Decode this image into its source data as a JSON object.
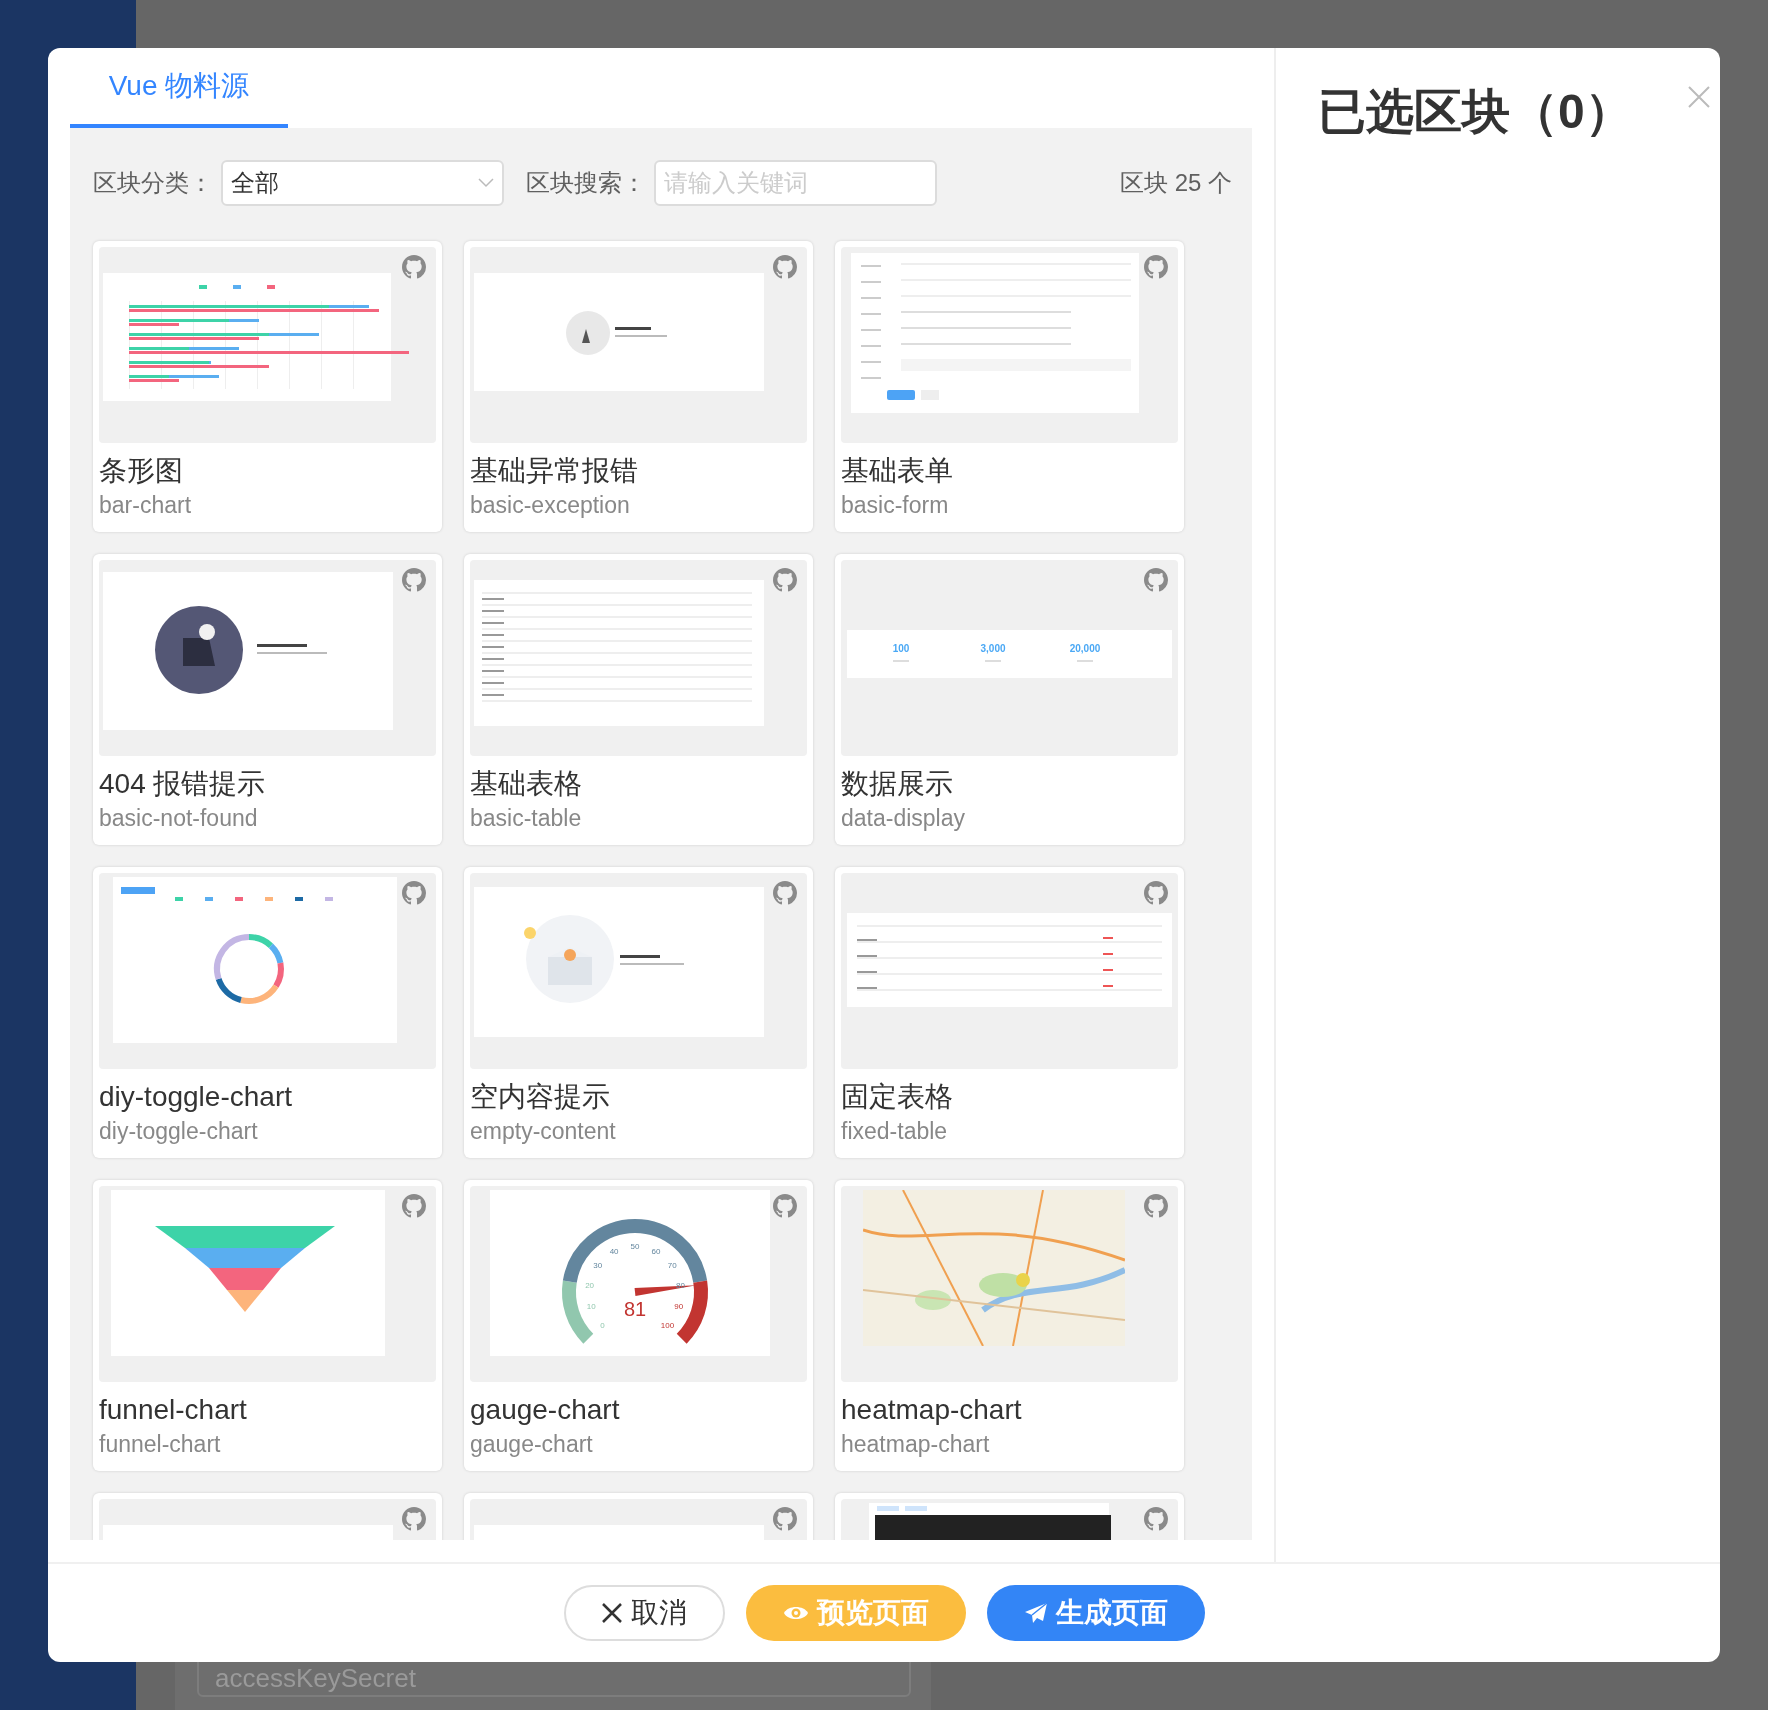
{
  "background": {
    "field_placeholder": "accessKeySecret"
  },
  "tab": {
    "label": "Vue 物料源",
    "selected": true
  },
  "filters": {
    "category_label": "区块分类：",
    "category_value": "全部",
    "search_label": "区块搜索：",
    "search_placeholder": "请输入关键词",
    "count": "区块 25 个"
  },
  "blocks": [
    {
      "title": "条形图",
      "name": "bar-chart",
      "kind": "bar"
    },
    {
      "title": "基础异常报错",
      "name": "basic-exception",
      "kind": "exception"
    },
    {
      "title": "基础表单",
      "name": "basic-form",
      "kind": "form"
    },
    {
      "title": "404 报错提示",
      "name": "basic-not-found",
      "kind": "notfound"
    },
    {
      "title": "基础表格",
      "name": "basic-table",
      "kind": "table"
    },
    {
      "title": "数据展示",
      "name": "data-display",
      "kind": "stats",
      "figures": [
        "100",
        "3,000",
        "20,000"
      ]
    },
    {
      "title": "diy-toggle-chart",
      "name": "diy-toggle-chart",
      "kind": "ring"
    },
    {
      "title": "空内容提示",
      "name": "empty-content",
      "kind": "empty"
    },
    {
      "title": "固定表格",
      "name": "fixed-table",
      "kind": "fixedtable"
    },
    {
      "title": "funnel-chart",
      "name": "funnel-chart",
      "kind": "funnel"
    },
    {
      "title": "gauge-chart",
      "name": "gauge-chart",
      "kind": "gauge",
      "reading": "81",
      "ticks": [
        "0",
        "10",
        "20",
        "30",
        "40",
        "50",
        "60",
        "70",
        "80",
        "90",
        "100"
      ]
    },
    {
      "title": "heatmap-chart",
      "name": "heatmap-chart",
      "kind": "map"
    },
    {
      "kind": "blank"
    },
    {
      "kind": "blank"
    },
    {
      "kind": "dark"
    }
  ],
  "selected_panel": {
    "title": "已选区块（0）"
  },
  "buttons": [
    {
      "kind": "cancel",
      "label": "取消"
    },
    {
      "kind": "preview",
      "label": "预览页面"
    },
    {
      "kind": "generate",
      "label": "生成页面"
    }
  ]
}
